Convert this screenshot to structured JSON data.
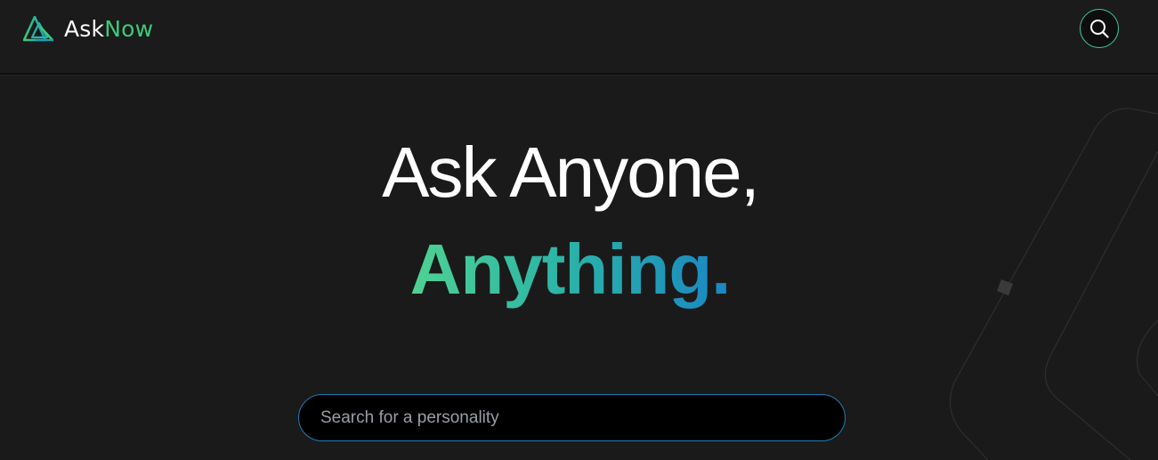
{
  "header": {
    "brand": {
      "name_part1": "Ask",
      "name_part2": "Now"
    },
    "search_button_icon": "search-icon"
  },
  "hero": {
    "line1": "Ask Anyone,",
    "line2": "Anything."
  },
  "search": {
    "placeholder": "Search for a personality",
    "value": ""
  },
  "colors": {
    "background": "#1a1a1a",
    "accent_green": "#3ec97a",
    "accent_teal": "#2ab2a8",
    "accent_blue": "#1a86c4",
    "search_border": "#1b7fb5"
  }
}
